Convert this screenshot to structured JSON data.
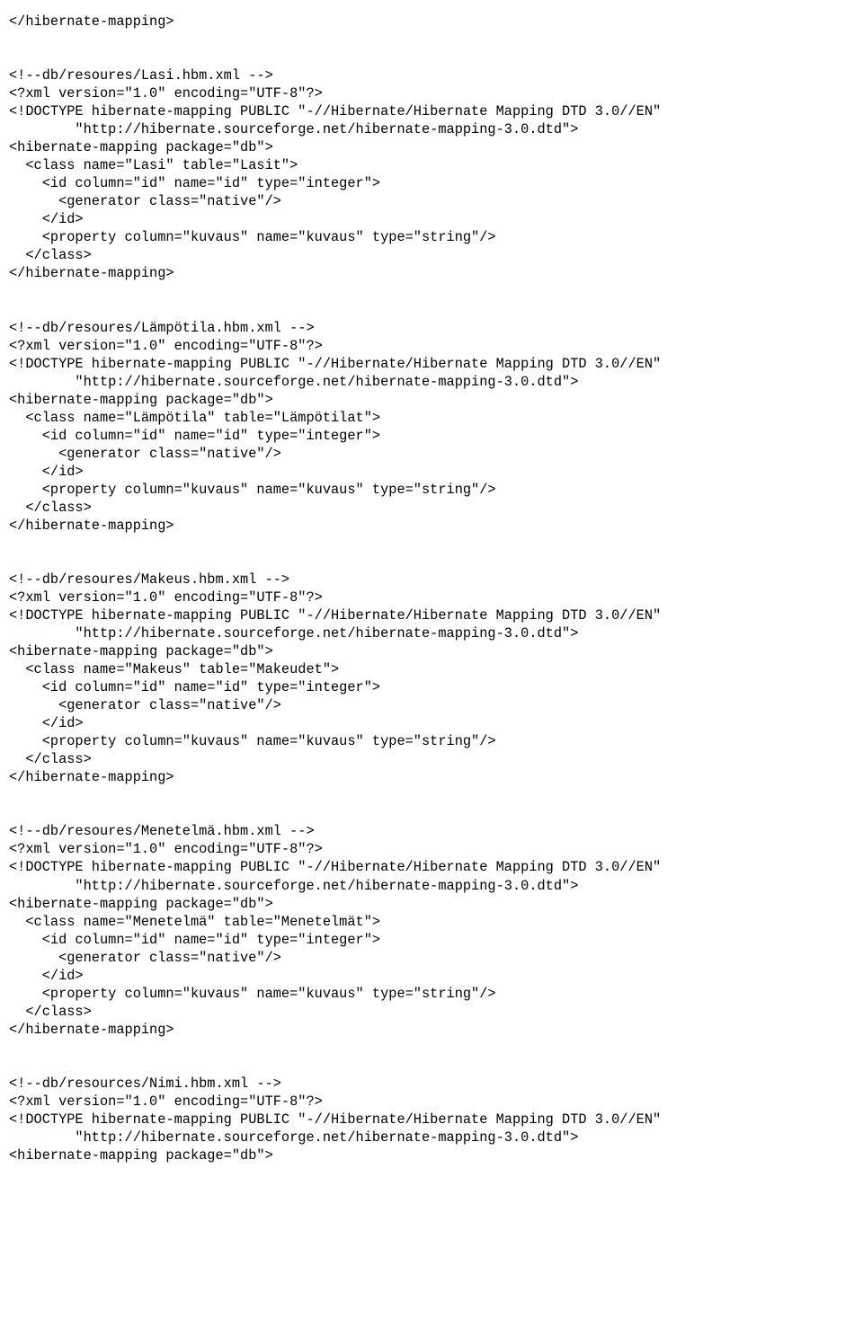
{
  "code": "</hibernate-mapping>\n\n\n<!--db/resoures/Lasi.hbm.xml -->\n<?xml version=\"1.0\" encoding=\"UTF-8\"?>\n<!DOCTYPE hibernate-mapping PUBLIC \"-//Hibernate/Hibernate Mapping DTD 3.0//EN\"\n        \"http://hibernate.sourceforge.net/hibernate-mapping-3.0.dtd\">\n<hibernate-mapping package=\"db\">\n  <class name=\"Lasi\" table=\"Lasit\">\n    <id column=\"id\" name=\"id\" type=\"integer\">\n      <generator class=\"native\"/>\n    </id>\n    <property column=\"kuvaus\" name=\"kuvaus\" type=\"string\"/>\n  </class>\n</hibernate-mapping>\n\n\n<!--db/resoures/Lämpötila.hbm.xml -->\n<?xml version=\"1.0\" encoding=\"UTF-8\"?>\n<!DOCTYPE hibernate-mapping PUBLIC \"-//Hibernate/Hibernate Mapping DTD 3.0//EN\"\n        \"http://hibernate.sourceforge.net/hibernate-mapping-3.0.dtd\">\n<hibernate-mapping package=\"db\">\n  <class name=\"Lämpötila\" table=\"Lämpötilat\">\n    <id column=\"id\" name=\"id\" type=\"integer\">\n      <generator class=\"native\"/>\n    </id>\n    <property column=\"kuvaus\" name=\"kuvaus\" type=\"string\"/>\n  </class>\n</hibernate-mapping>\n\n\n<!--db/resoures/Makeus.hbm.xml -->\n<?xml version=\"1.0\" encoding=\"UTF-8\"?>\n<!DOCTYPE hibernate-mapping PUBLIC \"-//Hibernate/Hibernate Mapping DTD 3.0//EN\"\n        \"http://hibernate.sourceforge.net/hibernate-mapping-3.0.dtd\">\n<hibernate-mapping package=\"db\">\n  <class name=\"Makeus\" table=\"Makeudet\">\n    <id column=\"id\" name=\"id\" type=\"integer\">\n      <generator class=\"native\"/>\n    </id>\n    <property column=\"kuvaus\" name=\"kuvaus\" type=\"string\"/>\n  </class>\n</hibernate-mapping>\n\n\n<!--db/resoures/Menetelmä.hbm.xml -->\n<?xml version=\"1.0\" encoding=\"UTF-8\"?>\n<!DOCTYPE hibernate-mapping PUBLIC \"-//Hibernate/Hibernate Mapping DTD 3.0//EN\"\n        \"http://hibernate.sourceforge.net/hibernate-mapping-3.0.dtd\">\n<hibernate-mapping package=\"db\">\n  <class name=\"Menetelmä\" table=\"Menetelmät\">\n    <id column=\"id\" name=\"id\" type=\"integer\">\n      <generator class=\"native\"/>\n    </id>\n    <property column=\"kuvaus\" name=\"kuvaus\" type=\"string\"/>\n  </class>\n</hibernate-mapping>\n\n\n<!--db/resources/Nimi.hbm.xml -->\n<?xml version=\"1.0\" encoding=\"UTF-8\"?>\n<!DOCTYPE hibernate-mapping PUBLIC \"-//Hibernate/Hibernate Mapping DTD 3.0//EN\"\n        \"http://hibernate.sourceforge.net/hibernate-mapping-3.0.dtd\">\n<hibernate-mapping package=\"db\">"
}
